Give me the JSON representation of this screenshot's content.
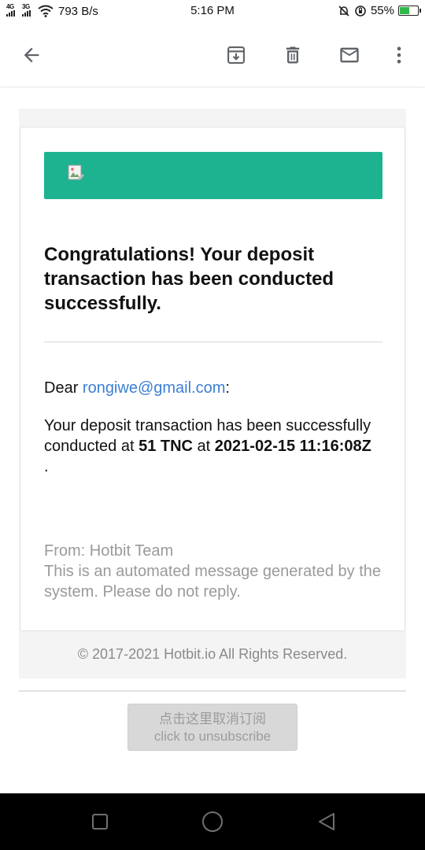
{
  "status_bar": {
    "signal_1": "4G",
    "signal_2": "3G",
    "speed": "793 B/s",
    "time": "5:16 PM",
    "battery_pct": "55%",
    "battery_level": 0.55
  },
  "toolbar": {
    "icons": [
      "back-arrow-icon",
      "archive-icon",
      "delete-icon",
      "mark-unread-icon",
      "more-vert-icon"
    ]
  },
  "email": {
    "banner_color": "#1db390",
    "headline": "Congratulations! Your deposit transaction has been conducted successfully.",
    "greeting_prefix": "Dear ",
    "recipient": "rongiwe@gmail.com",
    "greeting_suffix": ":",
    "message_part1": "Your deposit transaction has been successfully conducted at ",
    "amount": "51 TNC",
    "message_part2": " at ",
    "timestamp": "2021-02-15 11:16:08Z",
    "message_part3": " .",
    "from_line": "From: Hotbit Team",
    "auto_note": "This is an automated message generated by the system. Please do not reply.",
    "copyright": "© 2017-2021 Hotbit.io All Rights Reserved."
  },
  "unsubscribe": {
    "label_cn": "点击这里取消订阅",
    "label_en": "click to unsubscribe"
  },
  "nav_bar": {
    "icons": [
      "recents-square-icon",
      "home-circle-icon",
      "back-triangle-icon"
    ]
  }
}
